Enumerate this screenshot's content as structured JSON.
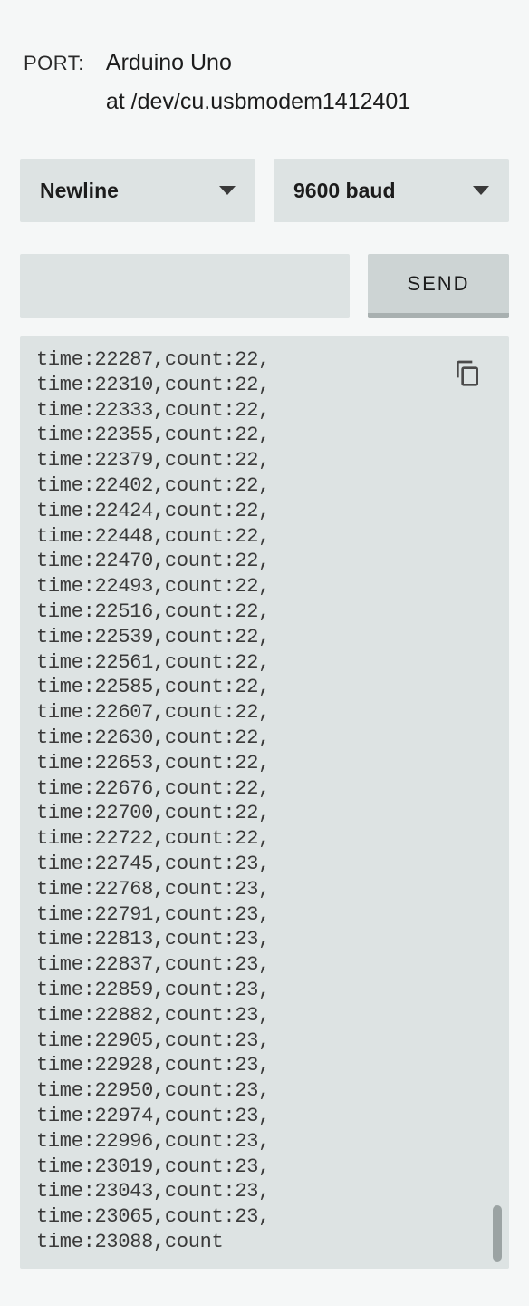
{
  "port": {
    "label": "PORT:",
    "device": "Arduino Uno",
    "path": "at /dev/cu.usbmodem1412401"
  },
  "dropdowns": {
    "line_ending": "Newline",
    "baud_rate": "9600 baud"
  },
  "send_button": "SEND",
  "input_value": "",
  "serial_lines": [
    "time:22287,count:22,",
    "time:22310,count:22,",
    "time:22333,count:22,",
    "time:22355,count:22,",
    "time:22379,count:22,",
    "time:22402,count:22,",
    "time:22424,count:22,",
    "time:22448,count:22,",
    "time:22470,count:22,",
    "time:22493,count:22,",
    "time:22516,count:22,",
    "time:22539,count:22,",
    "time:22561,count:22,",
    "time:22585,count:22,",
    "time:22607,count:22,",
    "time:22630,count:22,",
    "time:22653,count:22,",
    "time:22676,count:22,",
    "time:22700,count:22,",
    "time:22722,count:22,",
    "time:22745,count:23,",
    "time:22768,count:23,",
    "time:22791,count:23,",
    "time:22813,count:23,",
    "time:22837,count:23,",
    "time:22859,count:23,",
    "time:22882,count:23,",
    "time:22905,count:23,",
    "time:22928,count:23,",
    "time:22950,count:23,",
    "time:22974,count:23,",
    "time:22996,count:23,",
    "time:23019,count:23,",
    "time:23043,count:23,",
    "time:23065,count:23,",
    "time:23088,count"
  ]
}
